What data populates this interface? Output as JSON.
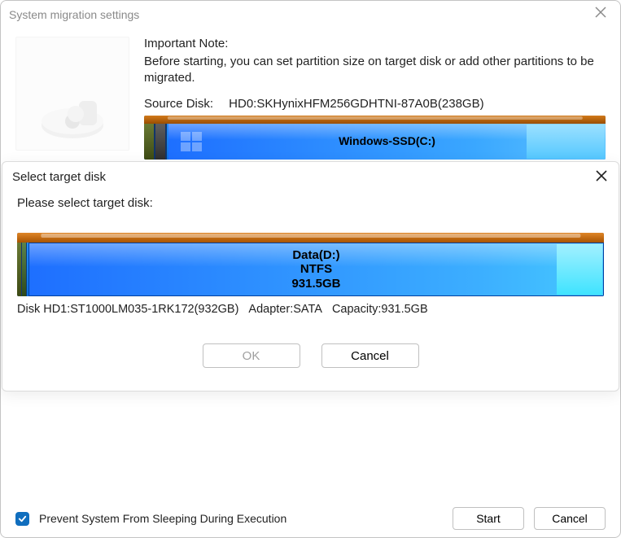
{
  "window": {
    "title": "System migration settings"
  },
  "note": {
    "heading": "Important Note:",
    "body": "Before starting, you can set partition size on target disk or add other partitions to be migrated."
  },
  "source": {
    "label": "Source Disk:",
    "value": "HD0:SKHynixHFM256GDHTNI-87A0B(238GB)",
    "partition_name": "Windows-SSD(C:)"
  },
  "overlay": {
    "title": "Select target disk",
    "prompt": "Please select target disk:",
    "target": {
      "name": "Data(D:)",
      "fs": "NTFS",
      "size": "931.5GB",
      "info_disk": "Disk HD1:ST1000LM035-1RK172(932GB)",
      "info_adapter": "Adapter:SATA",
      "info_capacity": "Capacity:931.5GB"
    },
    "ok": "OK",
    "cancel": "Cancel"
  },
  "footer": {
    "checkbox_label": "Prevent System From Sleeping During Execution",
    "start": "Start",
    "cancel": "Cancel"
  }
}
